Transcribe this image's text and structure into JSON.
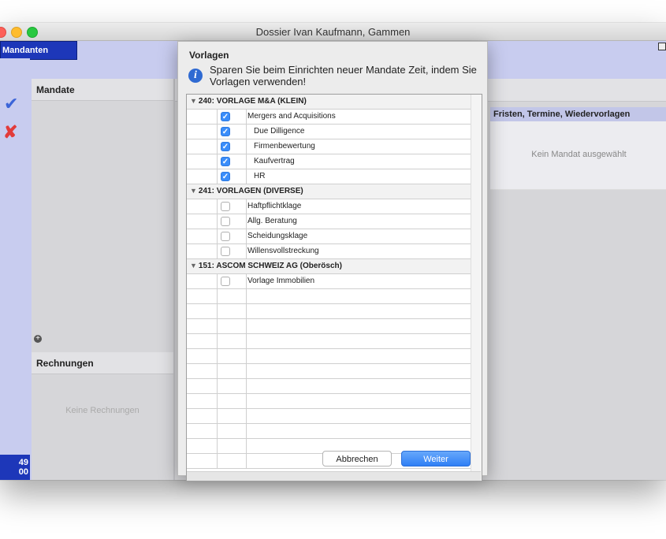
{
  "window": {
    "title": "Dossier Ivan Kaufmann, Gammen"
  },
  "sidebar": {
    "mandanten_label": "Mandanten",
    "counter": "49\n00"
  },
  "panels": {
    "mandate_title": "Mandate",
    "rechnungen_title": "Rechnungen",
    "no_rechnungen": "Keine Rechnungen",
    "fristen_title": "Fristen, Termine, Wiedervorlagen",
    "no_mandat": "Kein Mandat ausgewählt"
  },
  "dialog": {
    "title": "Vorlagen",
    "info_text": "Sparen Sie beim Einrichten neuer Mandate Zeit, indem Sie Vorlagen verwenden!",
    "groups": [
      {
        "label": "240: VORLAGE M&A (KLEIN)",
        "items": [
          {
            "label": "Mergers and Acquisitions",
            "checked": true,
            "indent": 0
          },
          {
            "label": "Due Dilligence",
            "checked": true,
            "indent": 1
          },
          {
            "label": "Firmenbewertung",
            "checked": true,
            "indent": 1
          },
          {
            "label": "Kaufvertrag",
            "checked": true,
            "indent": 1
          },
          {
            "label": "HR",
            "checked": true,
            "indent": 1
          }
        ]
      },
      {
        "label": "241: VORLAGEN (DIVERSE)",
        "items": [
          {
            "label": "Haftpflichtklage",
            "checked": false,
            "indent": 0
          },
          {
            "label": "Allg. Beratung",
            "checked": false,
            "indent": 0
          },
          {
            "label": "Scheidungsklage",
            "checked": false,
            "indent": 0
          },
          {
            "label": "Willensvollstreckung",
            "checked": false,
            "indent": 0
          }
        ]
      },
      {
        "label": "151: ASCOM SCHWEIZ AG (Oberösch)",
        "items": [
          {
            "label": "Vorlage Immobilien",
            "checked": false,
            "indent": 0
          }
        ]
      }
    ],
    "cancel_label": "Abbrechen",
    "next_label": "Weiter"
  }
}
